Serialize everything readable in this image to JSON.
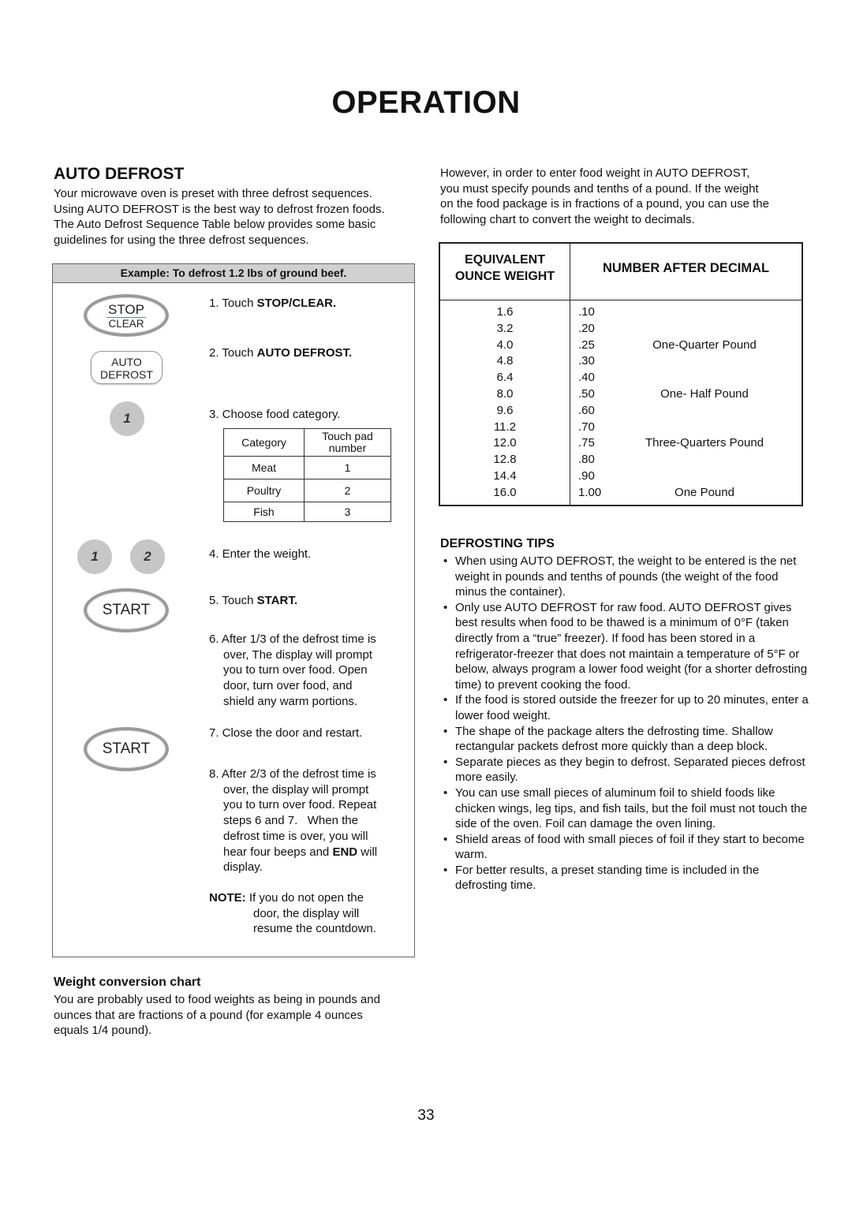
{
  "page": {
    "title": "OPERATION",
    "page_number": "33"
  },
  "auto_defrost": {
    "heading": "AUTO DEFROST",
    "intro_lines": [
      "Your microwave oven is preset with three defrost sequences.",
      "Using AUTO DEFROST is the best way to defrost frozen foods.",
      "The Auto Defrost Sequence Table below provides some basic",
      "guidelines for using the three defrost sequences."
    ]
  },
  "example": {
    "header": "Example: To defrost 1.2 lbs of ground beef.",
    "keys": {
      "stop_top": "STOP",
      "stop_bottom": "CLEAR",
      "auto_top": "AUTO",
      "auto_bottom": "DEFROST",
      "num1": "1",
      "num2": "2",
      "start": "START"
    },
    "steps": {
      "s1_prefix": "1. Touch ",
      "s1_bold": "STOP/CLEAR.",
      "s2_prefix": "2. Touch ",
      "s2_bold": "AUTO DEFROST.",
      "s3": "3. Choose food category.",
      "s4": "4. Enter the weight.",
      "s5_prefix": "5. Touch ",
      "s5_bold": "START.",
      "s6_lines": [
        "6. After 1/3 of the defrost time is",
        "over, The display will prompt",
        "you to turn over food. Open",
        "door, turn over food, and",
        "shield any warm portions."
      ],
      "s7": "7. Close the door and restart.",
      "s8_lines": [
        "8. After 2/3 of the defrost time is",
        "over, the display will prompt",
        "you to turn over food. Repeat",
        "steps 6 and 7.   When the",
        "defrost time is over, you will"
      ],
      "s8_line6_prefix": "hear four beeps and ",
      "s8_line6_bold": "END",
      "s8_line6_suffix": " will",
      "s8_line7": "display.",
      "note_label": "NOTE:",
      "note_lines": [
        " If you do not open the",
        "door, the display will",
        "resume the countdown."
      ]
    },
    "category_table": {
      "headers": [
        "Category",
        "Touch pad number"
      ],
      "header_touch_line1": "Touch pad",
      "header_touch_line2": "number",
      "rows": [
        {
          "category": "Meat",
          "pad": "1"
        },
        {
          "category": "Poultry",
          "pad": "2"
        },
        {
          "category": "Fish",
          "pad": "3"
        }
      ]
    }
  },
  "weight_conversion": {
    "heading": "Weight conversion chart",
    "lines": [
      "You are probably used to food weights as being in pounds and",
      "ounces that are fractions of a pound (for example 4 ounces",
      "equals 1/4 pound)."
    ]
  },
  "right_intro": {
    "lines": [
      "However, in order to enter food weight in AUTO DEFROST,",
      "you must specify pounds and tenths of a pound. If the weight",
      "on the food package is in fractions of a pound, you can use the",
      "following chart to convert the weight to decimals."
    ]
  },
  "conversion_table": {
    "header_col1_line1": "EQUIVALENT",
    "header_col1_line2": "OUNCE WEIGHT",
    "header_col2": "NUMBER AFTER DECIMAL",
    "rows": [
      {
        "ounces": "1.6",
        "decimal": ".10",
        "note": ""
      },
      {
        "ounces": "3.2",
        "decimal": ".20",
        "note": ""
      },
      {
        "ounces": "4.0",
        "decimal": ".25",
        "note": "One-Quarter Pound"
      },
      {
        "ounces": "4.8",
        "decimal": ".30",
        "note": ""
      },
      {
        "ounces": "6.4",
        "decimal": ".40",
        "note": ""
      },
      {
        "ounces": "8.0",
        "decimal": ".50",
        "note": "One- Half Pound"
      },
      {
        "ounces": "9.6",
        "decimal": ".60",
        "note": ""
      },
      {
        "ounces": "11.2",
        "decimal": ".70",
        "note": ""
      },
      {
        "ounces": "12.0",
        "decimal": ".75",
        "note": "Three-Quarters Pound"
      },
      {
        "ounces": "12.8",
        "decimal": ".80",
        "note": ""
      },
      {
        "ounces": "14.4",
        "decimal": ".90",
        "note": ""
      },
      {
        "ounces": "16.0",
        "decimal": "1.00",
        "note": "One Pound"
      }
    ]
  },
  "defrosting_tips": {
    "heading": "DEFROSTING TIPS",
    "items": [
      "When using AUTO DEFROST, the weight to be entered is the net weight in pounds and tenths of pounds (the weight of the food minus the container).",
      "Only use AUTO  DEFROST for raw food. AUTO DEFROST gives best results when food to be thawed is a minimum of 0°F (taken directly from a “true” freezer). If food has been stored in a refrigerator-freezer that does not maintain a temperature of  5°F or below, always program a lower food weight (for a shorter defrosting time) to prevent cooking the food.",
      "If the food is stored outside the freezer for up to 20 minutes, enter a lower food weight.",
      "The shape of the package alters the defrosting time. Shallow rectangular packets defrost more quickly than a deep block.",
      "Separate pieces as they begin to defrost. Separated pieces defrost more easily.",
      "You can use small pieces of aluminum foil to shield foods like chicken wings, leg tips, and fish tails, but the foil must not touch the side of the oven. Foil can damage the oven lining.",
      "Shield areas of food with small pieces of foil if they start to become warm.",
      "For better results, a preset standing time is included in the defrosting time."
    ]
  }
}
